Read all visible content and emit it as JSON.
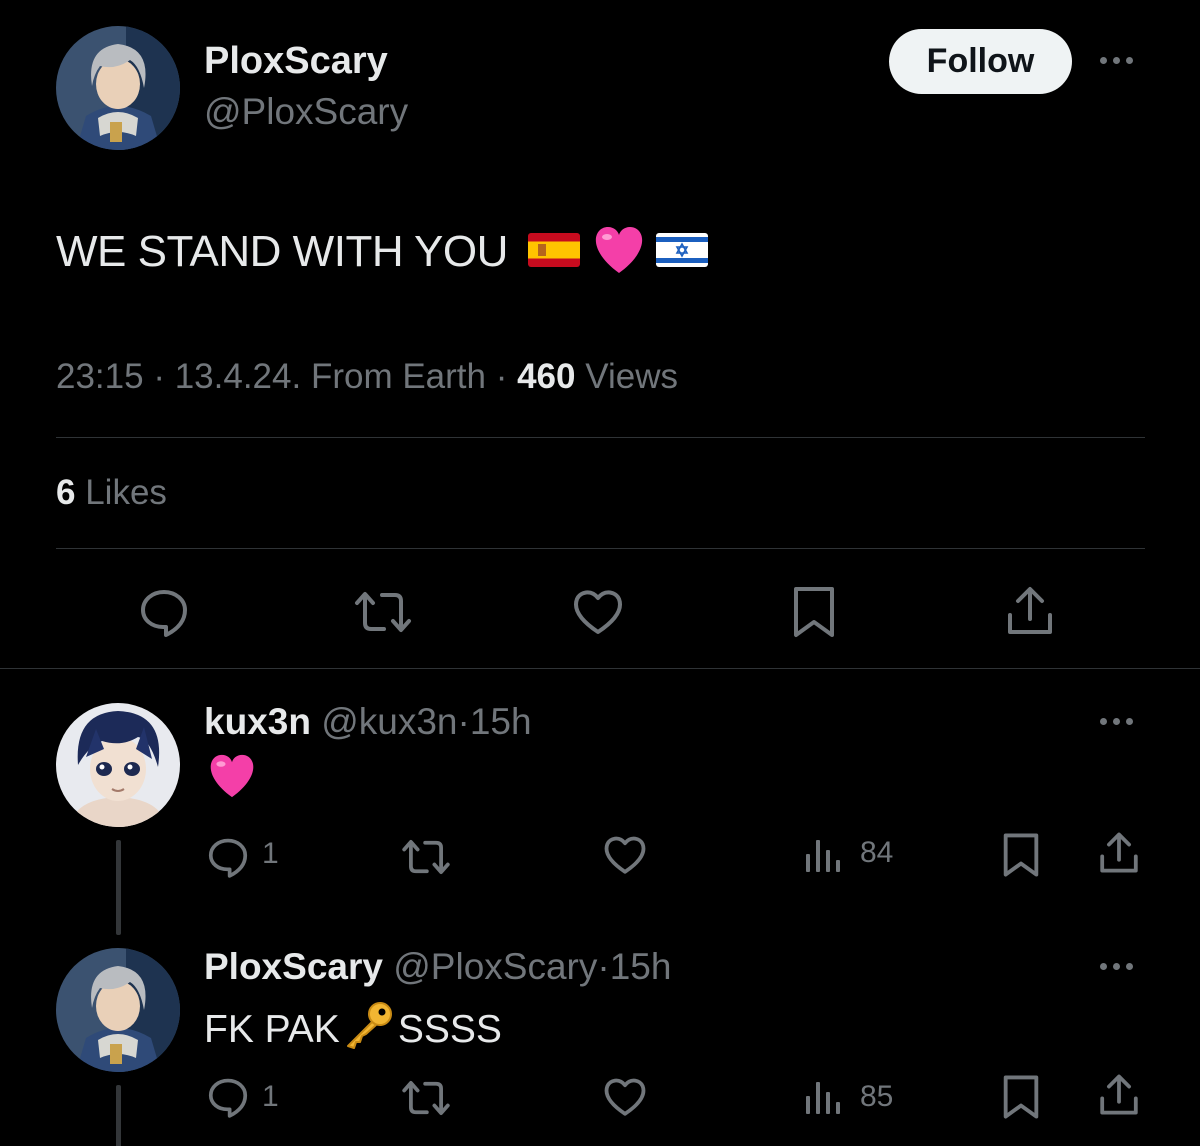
{
  "main_tweet": {
    "display_name": "PloxScary",
    "handle": "@PloxScary",
    "follow_label": "Follow",
    "text": "WE STAND WITH YOU",
    "emojis": [
      "spain-flag",
      "pink-heart",
      "israel-flag"
    ],
    "time": "23:15",
    "date": "13.4.24.",
    "location": "From Earth",
    "views_count": "460",
    "views_label": "Views",
    "likes_count": "6",
    "likes_label": "Likes"
  },
  "replies": [
    {
      "display_name": "kux3n",
      "handle": "@kux3n",
      "age": "15h",
      "reply_count": "1",
      "views": "84"
    },
    {
      "display_name": "PloxScary",
      "handle": "@PloxScary",
      "age": "15h",
      "text_before": "FK PAK",
      "text_after": "SSSS",
      "reply_count": "1",
      "views": "85"
    }
  ],
  "colors": {
    "background": "#000000",
    "text": "#e7e9ea",
    "muted": "#71767b",
    "divider": "#2f3336",
    "pink_heart": "#f43fa8"
  }
}
